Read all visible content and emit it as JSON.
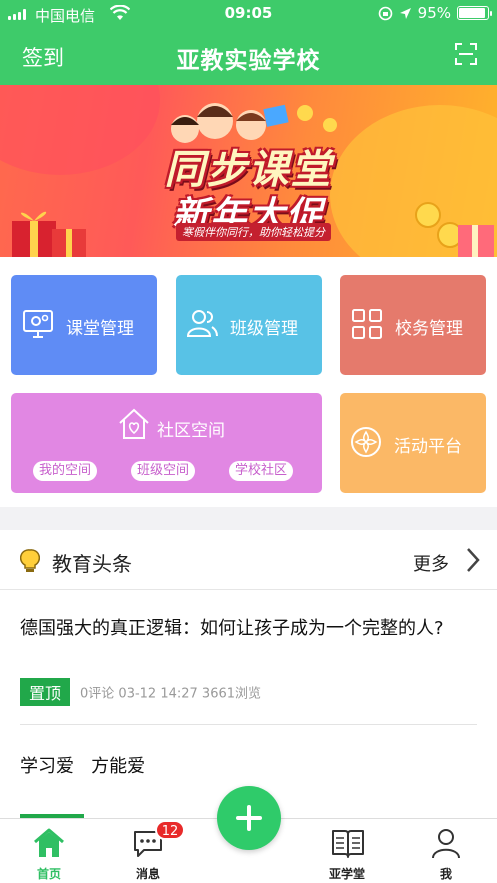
{
  "status": {
    "carrier": "中国电信",
    "time": "09:05",
    "battery": "95%",
    "battery_level": 0.95
  },
  "header": {
    "left_label": "签到",
    "title": "亚教实验学校"
  },
  "banner": {
    "title": "同步课堂",
    "subtitle": "新年大促",
    "caption": "寒假伴你同行，助你轻松提分"
  },
  "tiles": {
    "classroom": "课堂管理",
    "class": "班级管理",
    "school": "校务管理",
    "community": "社区空间",
    "community_chips": [
      "我的空间",
      "班级空间",
      "学校社区"
    ],
    "activity": "活动平台"
  },
  "colors": {
    "header": "#3ecb6a",
    "classroom": "#5f8cf5",
    "class": "#58c2e6",
    "school": "#e57a6c",
    "community": "#e187e3",
    "activity": "#fbb866"
  },
  "news": {
    "title": "教育头条",
    "more": "更多",
    "articles": [
      {
        "title": "德国强大的真正逻辑：如何让孩子成为一个完整的人?",
        "pin": "置顶",
        "meta": "0评论  03-12 14:27   3661浏览"
      },
      {
        "title": "学习爱   方能爱"
      }
    ]
  },
  "tabbar": {
    "home": "首页",
    "messages": "消息",
    "message_badge": "12",
    "yaxuetang": "亚学堂",
    "me": "我"
  }
}
